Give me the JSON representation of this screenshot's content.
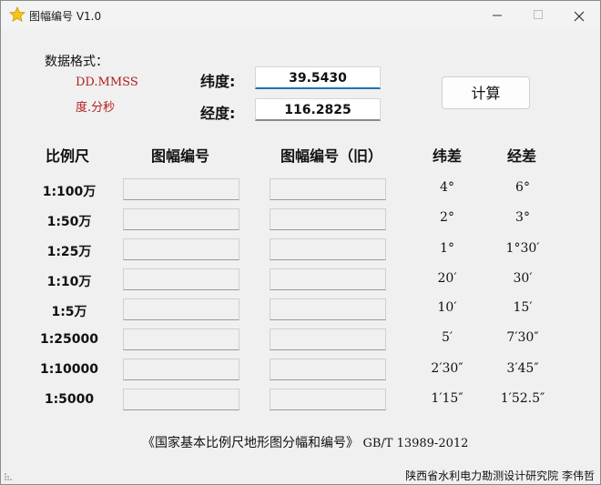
{
  "window": {
    "title": "图幅编号 V1.0"
  },
  "format": {
    "label": "数据格式：",
    "line1": "DD.MMSS",
    "line2": "度.分秒"
  },
  "inputs": {
    "lat_label": "纬度:",
    "lat_value": "39.5430",
    "lon_label": "经度:",
    "lon_value": "116.2825"
  },
  "calc_button": "计算",
  "table": {
    "headers": [
      "比例尺",
      "图幅编号",
      "图幅编号（旧）",
      "纬差",
      "经差"
    ],
    "rows": [
      {
        "scale": "1:100万",
        "lat_diff": "4°",
        "lon_diff": "6°"
      },
      {
        "scale": "1:50万",
        "lat_diff": "2°",
        "lon_diff": "3°"
      },
      {
        "scale": "1:25万",
        "lat_diff": "1°",
        "lon_diff": "1°30′"
      },
      {
        "scale": "1:10万",
        "lat_diff": "20′",
        "lon_diff": "30′"
      },
      {
        "scale": "1:5万",
        "lat_diff": "10′",
        "lon_diff": "15′"
      },
      {
        "scale": "1:25000",
        "lat_diff": "5′",
        "lon_diff": "7′30″"
      },
      {
        "scale": "1:10000",
        "lat_diff": "2′30″",
        "lon_diff": "3′45″"
      },
      {
        "scale": "1:5000",
        "lat_diff": "1′15″",
        "lon_diff": "1′52.5″"
      }
    ]
  },
  "footer": {
    "standard_title": "《国家基本比例尺地形图分幅和编号》",
    "standard_code": "GB/T 13989-2012"
  },
  "status": {
    "credit": "陕西省水利电力勘测设计研究院  李伟哲"
  }
}
